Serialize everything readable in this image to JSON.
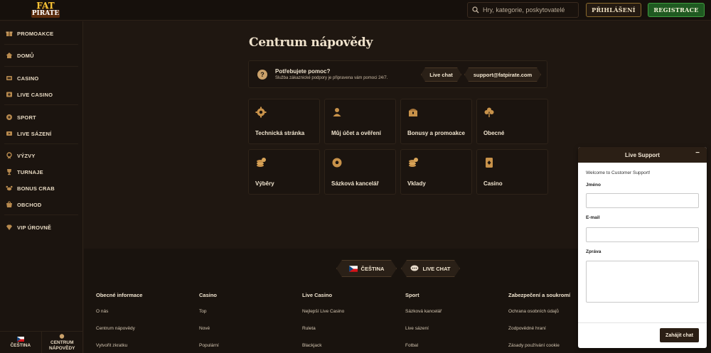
{
  "header": {
    "logo_line1": "FAT",
    "logo_line2": "PIRATE",
    "search_placeholder": "Hry, kategorie, poskytovatelé",
    "login_label": "PŘIHLÁŠENÍ",
    "register_label": "REGISTRACE"
  },
  "sidebar": {
    "items": [
      {
        "label": "PROMOAKCE",
        "icon": "gift-icon"
      },
      {
        "label": "DOMŮ",
        "icon": "home-icon"
      },
      {
        "label": "CASINO",
        "icon": "casino-icon"
      },
      {
        "label": "LIVE CASINO",
        "icon": "live-casino-icon"
      },
      {
        "label": "SPORT",
        "icon": "sport-ball-icon"
      },
      {
        "label": "LIVE SÁZENÍ",
        "icon": "live-bet-icon"
      },
      {
        "label": "VÝZVY",
        "icon": "challenge-icon"
      },
      {
        "label": "TURNAJE",
        "icon": "trophy-icon"
      },
      {
        "label": "BONUS CRAB",
        "icon": "crab-icon"
      },
      {
        "label": "OBCHOD",
        "icon": "shop-icon"
      },
      {
        "label": "VIP ÚROVNĚ",
        "icon": "vip-diamond-icon"
      }
    ],
    "bottom_language": "ČEŠTINA",
    "bottom_help_line1": "CENTRUM",
    "bottom_help_line2": "NÁPOVĚDY"
  },
  "main": {
    "title": "Centrum nápovědy",
    "banner": {
      "title": "Potřebujete pomoc?",
      "subtitle": "Služba zákaznické podpory je připravena vám pomoci 24/7.",
      "live_chat_label": "Live chat",
      "email_label": "support@fatpirate.com"
    },
    "cards": [
      {
        "label": "Technická stránka",
        "icon": "gear-icon"
      },
      {
        "label": "Můj účet a ověření",
        "icon": "account-icon"
      },
      {
        "label": "Bonusy a promoakce",
        "icon": "treasure-chest-icon"
      },
      {
        "label": "Obecné",
        "icon": "clover-icon"
      },
      {
        "label": "Výběry",
        "icon": "coins-icon"
      },
      {
        "label": "Sázková kancelář",
        "icon": "football-icon"
      },
      {
        "label": "Vklady",
        "icon": "deposit-coins-icon"
      },
      {
        "label": "Casino",
        "icon": "playing-card-icon"
      }
    ]
  },
  "footer": {
    "language_button": "ČEŠTINA",
    "live_chat_button": "LIVE CHAT",
    "columns": [
      {
        "heading": "Obecné informace",
        "links": [
          "O nás",
          "Centrum nápovědy",
          "Vytvořit zkratku"
        ]
      },
      {
        "heading": "Casino",
        "links": [
          "Top",
          "Nové",
          "Populární"
        ]
      },
      {
        "heading": "Live Casino",
        "links": [
          "Nejlepší Live Casino",
          "Ruleta",
          "Blackjack"
        ]
      },
      {
        "heading": "Sport",
        "links": [
          "Sázková kancelář",
          "Live sázení",
          "Fotbal"
        ]
      },
      {
        "heading": "Zabezpečení a soukromí",
        "links": [
          "Ochrana osobních údajů",
          "Zodpovědné hraní",
          "Zásady používání cookie"
        ]
      }
    ]
  },
  "widget": {
    "title": "Live Support",
    "minimize": "−",
    "welcome": "Welcome to Customer Support!",
    "name_label": "Jméno",
    "email_label": "E-mail",
    "message_label": "Zpráva",
    "submit_label": "Zahájit chat"
  },
  "colors": {
    "accent_gold": "#caa16a",
    "register_green": "#1f5a21",
    "background": "#1f1711"
  }
}
